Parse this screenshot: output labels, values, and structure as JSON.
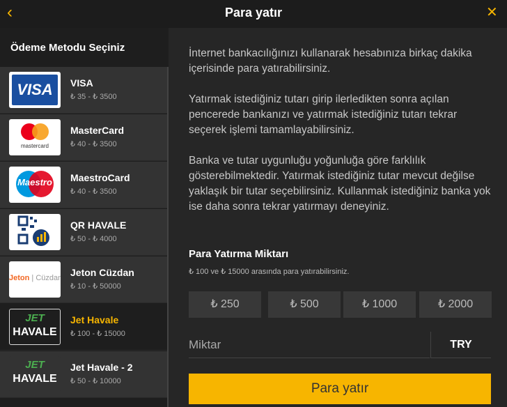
{
  "header": {
    "title": "Para yatır",
    "back_icon": "‹",
    "close_icon": "✕"
  },
  "sidebar": {
    "title": "Ödeme Metodu Seçiniz",
    "items": [
      {
        "name": "VISA",
        "range": "₺ 35 - ₺ 3500",
        "logo": "visa",
        "logo_text": "VISA"
      },
      {
        "name": "MasterCard",
        "range": "₺ 40 - ₺ 3500",
        "logo": "mastercard",
        "logo_text": "mastercard"
      },
      {
        "name": "MaestroCard",
        "range": "₺ 40 - ₺ 3500",
        "logo": "maestro",
        "logo_text": "Maestro"
      },
      {
        "name": "QR HAVALE",
        "range": "₺ 50 - ₺ 4000",
        "logo": "qr-havale"
      },
      {
        "name": "Jeton Cüzdan",
        "range": "₺ 10 - ₺ 50000",
        "logo": "jeton",
        "logo_text_a": "Jeton",
        "logo_text_b": "Cüzdan"
      },
      {
        "name": "Jet Havale",
        "range": "₺ 100 - ₺ 15000",
        "logo": "jet-havale",
        "logo_text_a": "JET",
        "logo_text_b": "HAVALE",
        "selected": true
      },
      {
        "name": "Jet Havale - 2",
        "range": "₺ 50 - ₺ 10000",
        "logo": "jet-havale",
        "logo_text_a": "JET",
        "logo_text_b": "HAVALE"
      }
    ]
  },
  "main": {
    "paragraphs": [
      "İnternet bankacılığınızı kullanarak hesabınıza birkaç dakika içerisinde para yatırabilirsiniz.",
      "Yatırmak istediğiniz tutarı girip ilerledikten sonra açılan pencerede bankanızı ve yatırmak istediğiniz tutarı tekrar seçerek işlemi tamamlayabilirsiniz.",
      "Banka ve tutar uygunluğu yoğunluğa göre farklılık gösterebilmektedir. Yatırmak istediğiniz tutar mevcut değilse yaklaşık bir tutar seçebilirsiniz. Kullanmak istediğiniz banka yok ise daha sonra tekrar yatırmayı deneyiniz."
    ],
    "amount_title": "Para Yatırma Miktarı",
    "amount_note": "₺ 100 ve ₺ 15000 arasında para yatırabilirsiniz.",
    "presets": [
      "₺ 250",
      "₺ 500",
      "₺ 1000",
      "₺ 2000"
    ],
    "amount_placeholder": "Miktar",
    "currency": "TRY",
    "submit_label": "Para yatır"
  },
  "colors": {
    "accent": "#f7b500",
    "background": "#262626",
    "sidebar": "#1e1e1e"
  }
}
